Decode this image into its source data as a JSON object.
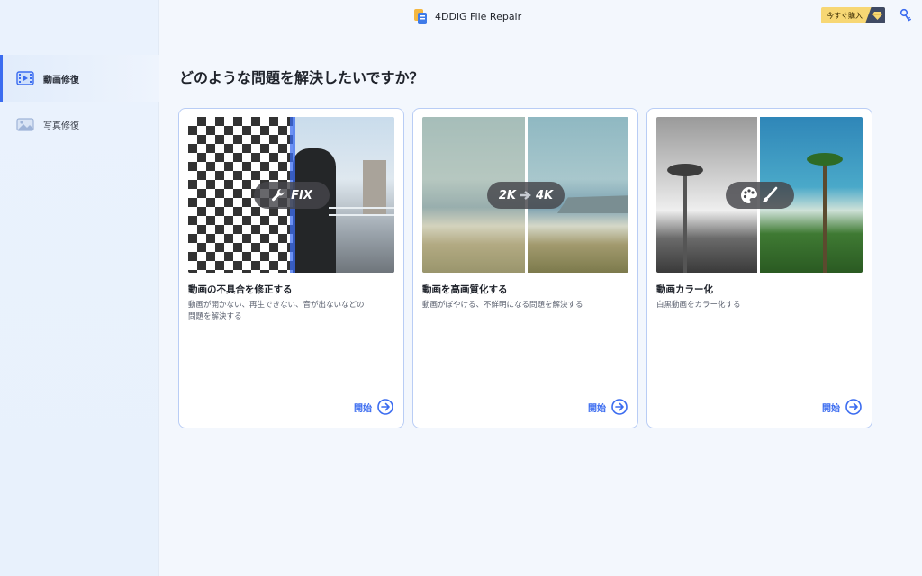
{
  "app": {
    "title": "4DDiG File Repair",
    "buy_label": "今すぐ購入"
  },
  "sidebar": {
    "items": [
      {
        "label": "動画修復",
        "icon": "video-icon",
        "active": true
      },
      {
        "label": "写真修復",
        "icon": "photo-icon",
        "active": false
      }
    ]
  },
  "main": {
    "heading": "どのような問題を解決したいですか？",
    "cards": [
      {
        "badge": "FIX",
        "title": "動画の不具合を修正する",
        "description": "動画が開かない、再生できない、音が出ないなどの問題を解決する",
        "action": "開始"
      },
      {
        "badge_from": "2K",
        "badge_to": "4K",
        "title": "動画を高画質化する",
        "description": "動画がぼやける、不鮮明になる問題を解決する",
        "action": "開始"
      },
      {
        "badge_icon": "palette-brush-icon",
        "title": "動画カラー化",
        "description": "白黒動画をカラー化する",
        "action": "開始"
      }
    ]
  },
  "colors": {
    "accent": "#3b6cf0",
    "card_border": "#b9cdf5",
    "buy_button": "#f7d774"
  }
}
